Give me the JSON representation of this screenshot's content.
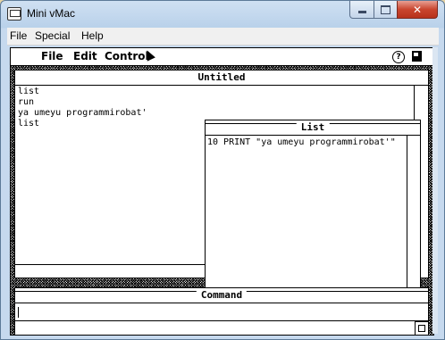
{
  "window": {
    "title": "Mini vMac",
    "menu": [
      "File",
      "Special",
      "Help"
    ]
  },
  "mac": {
    "menubar": {
      "apple_glyph": "",
      "items": [
        "File",
        "Edit",
        "Control"
      ],
      "help_glyph": "?"
    },
    "untitled_window": {
      "title": "Untitled",
      "lines": [
        "list",
        "run",
        "ya umeyu programmirobat'",
        "list"
      ]
    },
    "list_window": {
      "title": "List",
      "lines": [
        "10 PRINT \"ya umeyu programmirobat'\""
      ]
    },
    "command_window": {
      "title": "Command",
      "input_value": ""
    }
  }
}
